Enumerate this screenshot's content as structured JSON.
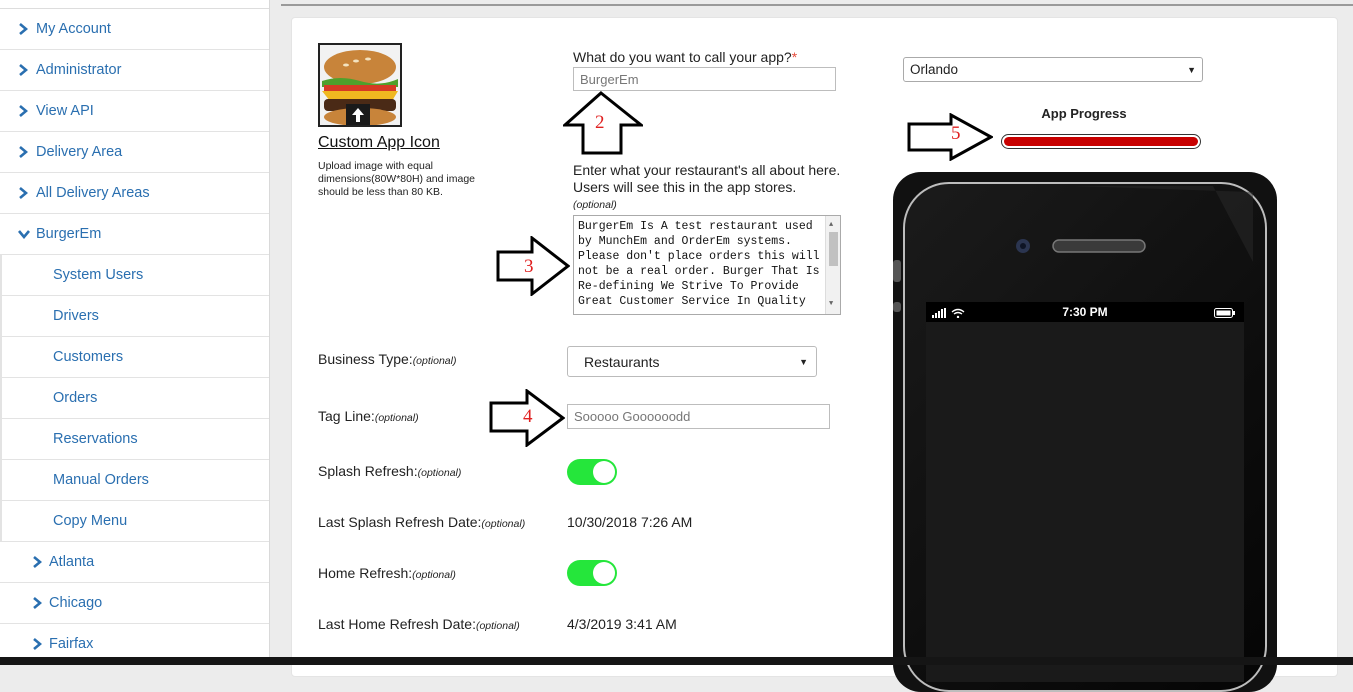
{
  "sidebar": {
    "items": [
      {
        "label": "My Account"
      },
      {
        "label": "Administrator"
      },
      {
        "label": "View API"
      },
      {
        "label": "Delivery Area"
      },
      {
        "label": "All Delivery Areas"
      },
      {
        "label": "BurgerEm"
      }
    ],
    "sub_items": [
      {
        "label": "System Users"
      },
      {
        "label": "Drivers"
      },
      {
        "label": "Customers"
      },
      {
        "label": "Orders"
      },
      {
        "label": "Reservations"
      },
      {
        "label": "Manual Orders"
      },
      {
        "label": "Copy Menu"
      }
    ],
    "cities": [
      {
        "label": "Atlanta"
      },
      {
        "label": "Chicago"
      },
      {
        "label": "Fairfax"
      }
    ]
  },
  "icon_section": {
    "label": "Custom App Icon",
    "hint": "Upload image with equal dimensions(80W*80H) and image should be less than 80 KB."
  },
  "app_name": {
    "label": "What do you want to call your app?",
    "required_mark": "*",
    "value": "BurgerEm"
  },
  "description": {
    "label": "Enter what your restaurant's all about here. Users will see this in the app stores.",
    "optional": "(optional)",
    "value": "BurgerEm Is A test restaurant used by MunchEm and OrderEm systems. Please don't place orders this will not be a real order. Burger That Is Re-defining We Strive To Provide Great Customer Service In Quality"
  },
  "optional_text": "(optional)",
  "business_type": {
    "label": "Business Type:",
    "value": "Restaurants"
  },
  "tag_line": {
    "label": "Tag Line:",
    "value": "Sooooo Goooooodd"
  },
  "splash_refresh": {
    "label": "Splash Refresh:",
    "on": true
  },
  "last_splash": {
    "label": "Last Splash Refresh Date:",
    "value": "10/30/2018 7:26 AM"
  },
  "home_refresh": {
    "label": "Home Refresh:",
    "on": true
  },
  "last_home": {
    "label": "Last Home Refresh Date:",
    "value": "4/3/2019 3:41 AM"
  },
  "city_select": {
    "value": "Orlando"
  },
  "progress": {
    "label": "App Progress",
    "percent": 100,
    "color": "#c80000"
  },
  "phone": {
    "time": "7:30 PM"
  },
  "annotations": [
    "2",
    "3",
    "4",
    "5"
  ],
  "colors": {
    "link": "#2a6fb0",
    "toggle_on": "#25e63b",
    "required": "#e74c3c"
  }
}
